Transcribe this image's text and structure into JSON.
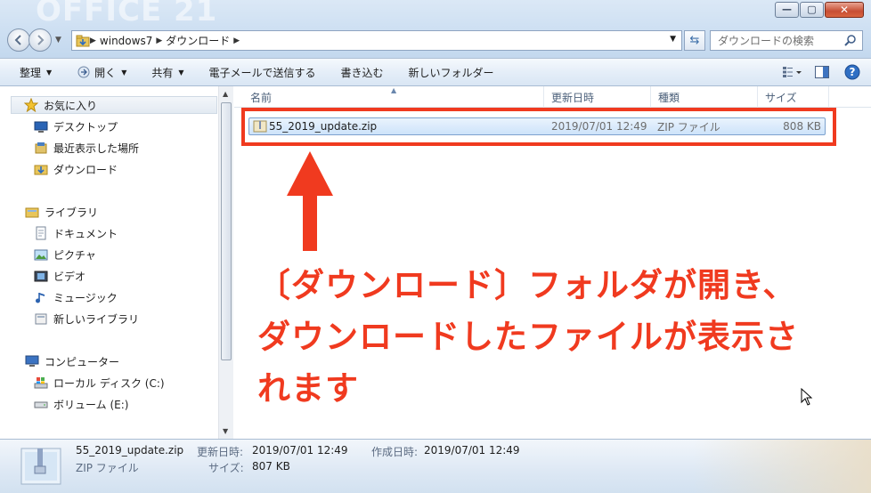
{
  "window": {
    "logo_text": "OFFICE 21",
    "buttons": {
      "minimize": "—",
      "maximize": "▢",
      "close": "✕"
    }
  },
  "address_bar": {
    "crumbs": [
      "windows7",
      "ダウンロード"
    ]
  },
  "search": {
    "placeholder": "ダウンロードの検索"
  },
  "toolbar": {
    "organize": "整理",
    "open": "開く",
    "share": "共有",
    "email": "電子メールで送信する",
    "burn": "書き込む",
    "new_folder": "新しいフォルダー"
  },
  "nav_pane": {
    "favorites": "お気に入り",
    "desktop": "デスクトップ",
    "recent": "最近表示した場所",
    "downloads": "ダウンロード",
    "libraries": "ライブラリ",
    "documents": "ドキュメント",
    "pictures": "ピクチャ",
    "videos": "ビデオ",
    "music": "ミュージック",
    "new_library": "新しいライブラリ",
    "computer": "コンピューター",
    "local_disk": "ローカル ディスク (C:)",
    "volume_e": "ボリューム (E:)"
  },
  "columns": {
    "name": "名前",
    "modified": "更新日時",
    "type": "種類",
    "size": "サイズ"
  },
  "file": {
    "name": "55_2019_update.zip",
    "modified": "2019/07/01 12:49",
    "type": "ZIP ファイル",
    "size": "808 KB"
  },
  "annotation": {
    "line1": "〔ダウンロード〕フォルダが開き、",
    "line2": "ダウンロードしたファイルが表示さ",
    "line3": "れます"
  },
  "details": {
    "name": "55_2019_update.zip",
    "type": "ZIP ファイル",
    "modified_label": "更新日時:",
    "modified_value": "2019/07/01 12:49",
    "created_label": "作成日時:",
    "created_value": "2019/07/01 12:49",
    "size_label": "サイズ:",
    "size_value": "807 KB"
  },
  "colors": {
    "accent_red": "#f03a1f",
    "selection_blue": "#cde3fa",
    "toolbar_bg": "#e5eef8"
  }
}
